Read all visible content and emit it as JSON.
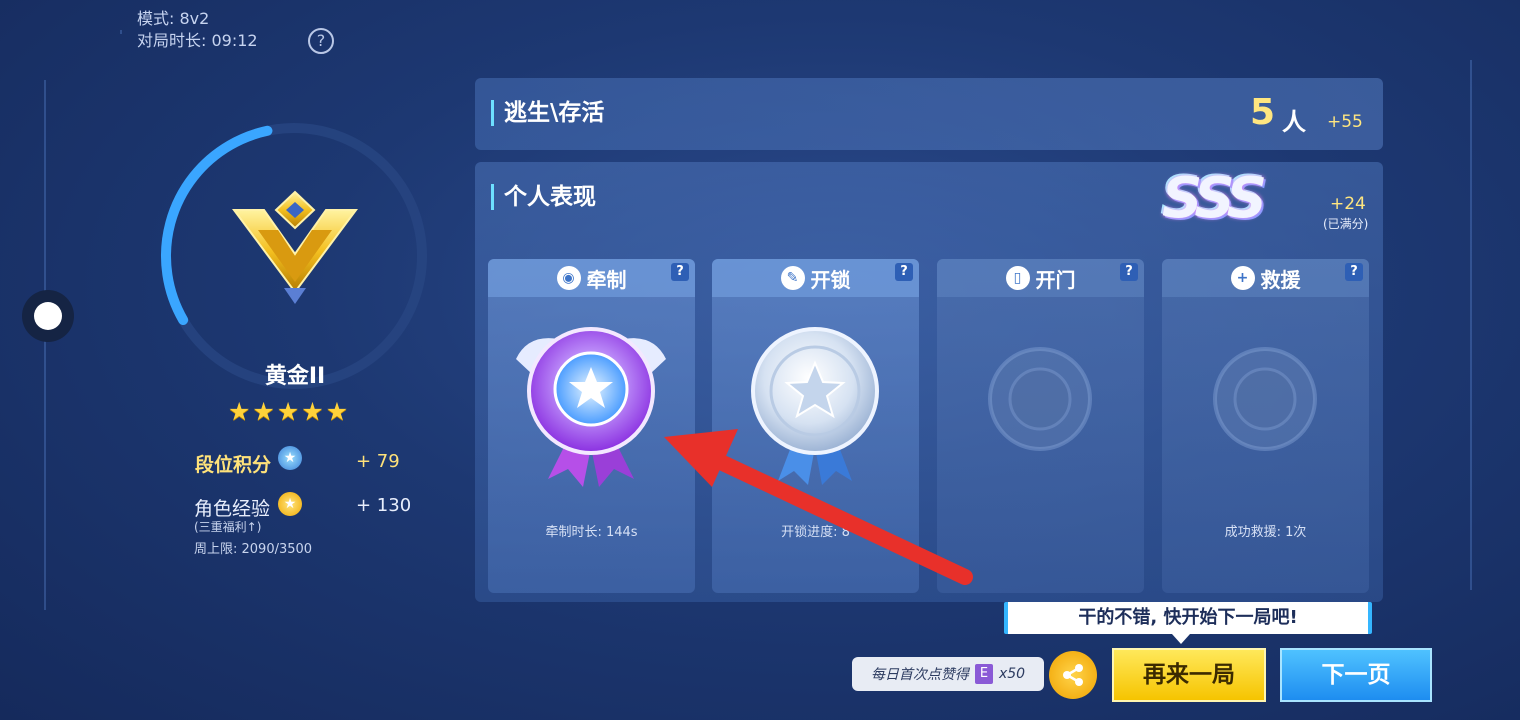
{
  "header": {
    "mode_label": "模式: 8v2",
    "duration_label": "对局时长: 09:12",
    "help_symbol": "?"
  },
  "rank": {
    "name": "黄金II",
    "stars": 5,
    "star_glyph": "★",
    "points_label": "段位积分",
    "points_value": "+ 79",
    "exp_label": "角色经验",
    "exp_value": "+ 130",
    "exp_note": "(三重福利↑)",
    "weekly_cap": "周上限: 2090/3500",
    "progress": 0.3
  },
  "escape": {
    "title": "逃生\\存活",
    "count": "5",
    "unit": "人",
    "bonus": "+55"
  },
  "performance": {
    "title": "个人表现",
    "grade": "SSS",
    "bonus": "+24",
    "note": "(已满分)"
  },
  "cards": [
    {
      "title": "牵制",
      "icon": "restraint-icon",
      "icon_glyph": "◉",
      "footer": "牵制时长: 144s",
      "medal": "purple-diamond"
    },
    {
      "title": "开锁",
      "icon": "wrench-icon",
      "icon_glyph": "✎",
      "footer": "开锁进度: 8",
      "medal": "silver"
    },
    {
      "title": "开门",
      "icon": "door-icon",
      "icon_glyph": "▯",
      "footer": "",
      "medal": "empty"
    },
    {
      "title": "救援",
      "icon": "rescue-icon",
      "icon_glyph": "+",
      "footer": "成功救援: 1次",
      "medal": "empty"
    }
  ],
  "card_help": "?",
  "bottom": {
    "tooltip": "干的不错, 快开始下一局吧!",
    "like_tip": "每日首次点赞得",
    "like_icon_glyph": "E",
    "like_reward": "x50",
    "again_button": "再来一局",
    "next_button": "下一页"
  },
  "colors": {
    "accent_gold": "#ffe680",
    "accent_cyan": "#6ee0ff",
    "again_button": "#f6c400",
    "next_button": "#1e8df0",
    "arrow_red": "#e8302a"
  }
}
